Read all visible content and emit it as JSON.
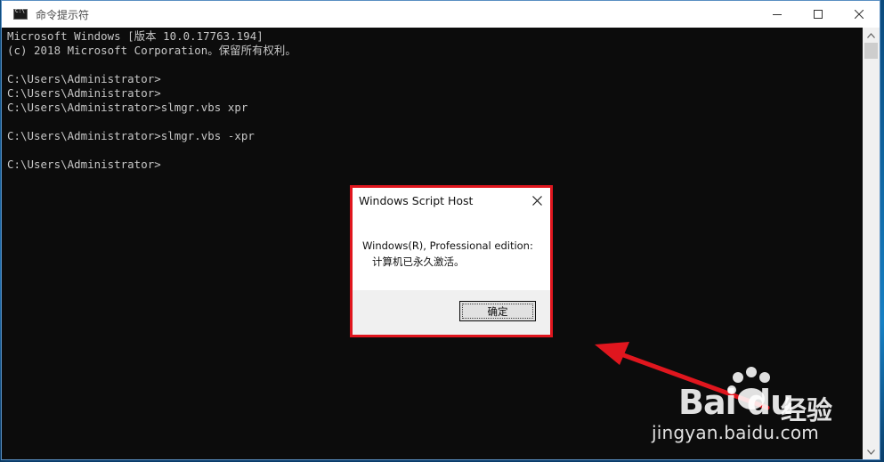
{
  "window": {
    "title": "命令提示符",
    "controls": {
      "minimize": "minimize-icon",
      "maximize": "maximize-icon",
      "close": "close-icon"
    }
  },
  "console": {
    "lines": [
      "Microsoft Windows [版本 10.0.17763.194]",
      "(c) 2018 Microsoft Corporation。保留所有权利。",
      "",
      "C:\\Users\\Administrator>",
      "C:\\Users\\Administrator>",
      "C:\\Users\\Administrator>slmgr.vbs xpr",
      "",
      "C:\\Users\\Administrator>slmgr.vbs -xpr",
      "",
      "C:\\Users\\Administrator>"
    ]
  },
  "dialog": {
    "title": "Windows Script Host",
    "message_line1": "Windows(R), Professional edition:",
    "message_line2": "计算机已永久激活。",
    "ok_label": "确定"
  },
  "watermark": {
    "brand_logo_text": "Bai du",
    "brand_product": "经验",
    "url": "jingyan.baidu.com"
  },
  "colors": {
    "console_bg": "#0c0c0c",
    "console_text": "#c7c7c7",
    "highlight_border": "#e0161e",
    "annotation_arrow": "#e0161e"
  }
}
